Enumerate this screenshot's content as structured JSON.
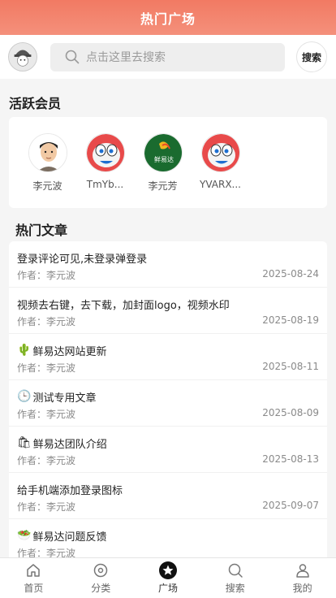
{
  "header": {
    "title": "热门广场"
  },
  "search": {
    "placeholder": "点击这里去搜索",
    "button_label": "搜索"
  },
  "members": {
    "title": "活跃会员",
    "items": [
      {
        "name": "李元波",
        "avatar": "cartoon-man"
      },
      {
        "name": "TmYb...",
        "avatar": "robot-face"
      },
      {
        "name": "李元芳",
        "avatar": "green-logo",
        "logo_text": "鲜易达"
      },
      {
        "name": "YVARX...",
        "avatar": "robot-face"
      }
    ]
  },
  "articles": {
    "title": "热门文章",
    "items": [
      {
        "emoji": "",
        "title": "登录评论可见,未登录弹登录",
        "author": "作者：李元波",
        "date": "2025-08-24"
      },
      {
        "emoji": "",
        "title": "视频去右键，去下载，加封面logo，视频水印",
        "author": "作者：李元波",
        "date": "2025-08-19"
      },
      {
        "emoji": "🌵",
        "title": "鲜易达网站更新",
        "author": "作者：李元波",
        "date": "2025-08-11"
      },
      {
        "emoji": "🕒",
        "title": "测试专用文章",
        "author": "作者：李元波",
        "date": "2025-08-09"
      },
      {
        "emoji": "🛍",
        "title": "鲜易达团队介绍",
        "author": "作者：李元波",
        "date": "2025-08-13"
      },
      {
        "emoji": "",
        "title": "给手机端添加登录图标",
        "author": "作者：李元波",
        "date": "2025-09-07"
      },
      {
        "emoji": "🥗",
        "title": "鲜易达问题反馈",
        "author": "作者：李元波",
        "date": ""
      }
    ]
  },
  "tabbar": {
    "items": [
      {
        "label": "首页",
        "icon": "home-icon"
      },
      {
        "label": "分类",
        "icon": "category-icon"
      },
      {
        "label": "广场",
        "icon": "star-icon",
        "active": true
      },
      {
        "label": "搜索",
        "icon": "search-icon"
      },
      {
        "label": "我的",
        "icon": "user-icon"
      }
    ]
  },
  "colors": {
    "header": "#f27a63",
    "active_tab_circle": "#111111",
    "logo_green": "#1a6b2f"
  }
}
